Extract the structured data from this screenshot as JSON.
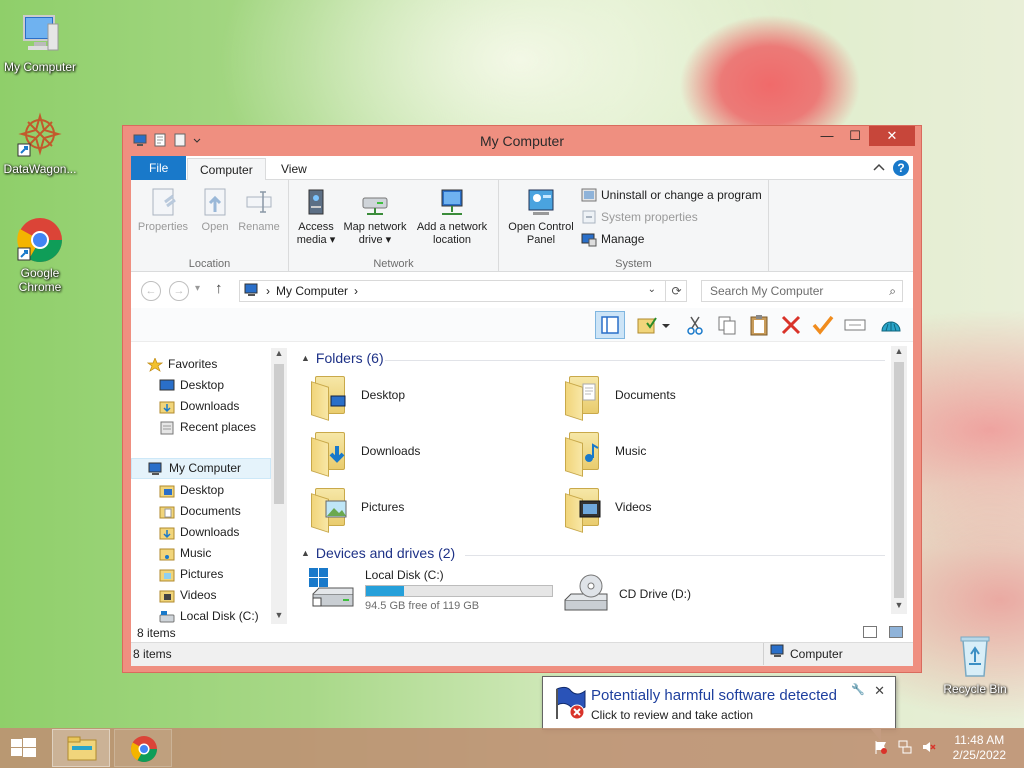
{
  "desktop": {
    "icons": [
      {
        "label": "My Computer"
      },
      {
        "label": "DataWagon..."
      },
      {
        "label": "Google Chrome"
      },
      {
        "label": "Recycle Bin"
      }
    ]
  },
  "window": {
    "title": "My Computer",
    "controls": {
      "minimize": "—",
      "maximize": "☐",
      "close": "✕"
    }
  },
  "ribbon": {
    "tabs": {
      "file": "File",
      "computer": "Computer",
      "view": "View"
    },
    "help": "?",
    "groups": {
      "location": {
        "name": "Location",
        "buttons": [
          {
            "label": "Properties"
          },
          {
            "label": "Open"
          },
          {
            "label": "Rename"
          }
        ]
      },
      "network": {
        "name": "Network",
        "buttons": [
          {
            "label_line1": "Access",
            "label_line2": "media ▾"
          },
          {
            "label_line1": "Map network",
            "label_line2": "drive ▾"
          },
          {
            "label_line1": "Add a network",
            "label_line2": "location"
          }
        ]
      },
      "system": {
        "name": "System",
        "open_control_panel": {
          "label_line1": "Open Control",
          "label_line2": "Panel"
        },
        "uninstall": "Uninstall or change a program",
        "system_properties": "System properties",
        "manage": "Manage"
      }
    }
  },
  "address": {
    "back": "←",
    "forward": "→",
    "recent": "▾",
    "up": "↑",
    "path_chevron": "›",
    "path": "My Computer",
    "path_chevron_after": "›",
    "dropdown": "⌄",
    "refresh": "⟳",
    "search_placeholder": "Search My Computer",
    "search_icon": "⌕"
  },
  "navpane": {
    "favorites": "Favorites",
    "fav_items": [
      "Desktop",
      "Downloads",
      "Recent places"
    ],
    "computer": "My Computer",
    "computer_items": [
      "Desktop",
      "Documents",
      "Downloads",
      "Music",
      "Pictures",
      "Videos",
      "Local Disk (C:)"
    ]
  },
  "content": {
    "folders_header": "Folders (6)",
    "folders": [
      "Desktop",
      "Documents",
      "Downloads",
      "Music",
      "Pictures",
      "Videos"
    ],
    "devices_header": "Devices and drives (2)",
    "local_disk": {
      "name": "Local Disk (C:)",
      "free": "94.5 GB free of 119 GB",
      "used_fraction": 0.206
    },
    "cd_drive": {
      "name": "CD Drive (D:)"
    }
  },
  "status": {
    "items": "8 items",
    "bottom_items": "8 items",
    "zone": "Computer"
  },
  "balloon": {
    "title": "Potentially harmful software detected",
    "body": "Click to review and take action",
    "close": "✕"
  },
  "taskbar": {
    "time": "11:48 AM",
    "date": "2/25/2022"
  },
  "colors": {
    "window_frame": "#ef8f80",
    "accent": "#1979ca",
    "close_button": "#c7463a",
    "progress": "#26a0da"
  }
}
